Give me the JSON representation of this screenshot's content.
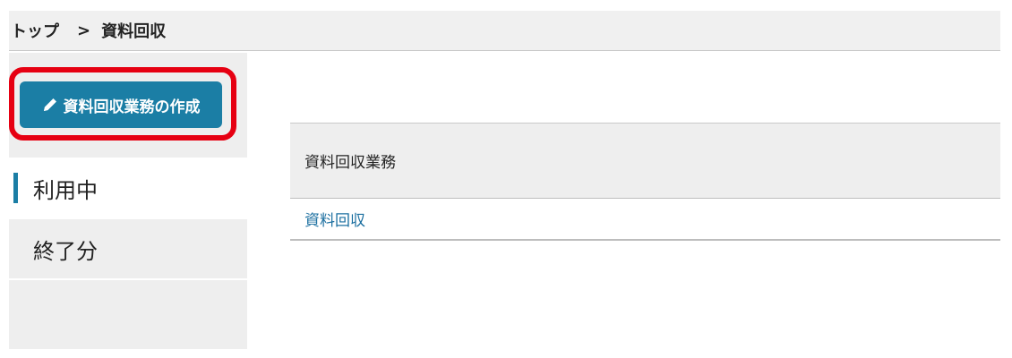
{
  "breadcrumb": {
    "home": "トップ",
    "separator": ">",
    "current": "資料回収"
  },
  "sidebar": {
    "create_button": {
      "label": "資料回収業務の作成",
      "icon": "pencil-icon"
    },
    "items": [
      {
        "label": "利用中",
        "active": true
      },
      {
        "label": "終了分",
        "active": false
      }
    ]
  },
  "table": {
    "header": "資料回収業務",
    "rows": [
      {
        "label": "資料回収"
      }
    ]
  },
  "colors": {
    "accent": "#1b7ea5",
    "highlight": "#e60012",
    "link": "#1b6fa0",
    "panel": "#eeeeee"
  }
}
